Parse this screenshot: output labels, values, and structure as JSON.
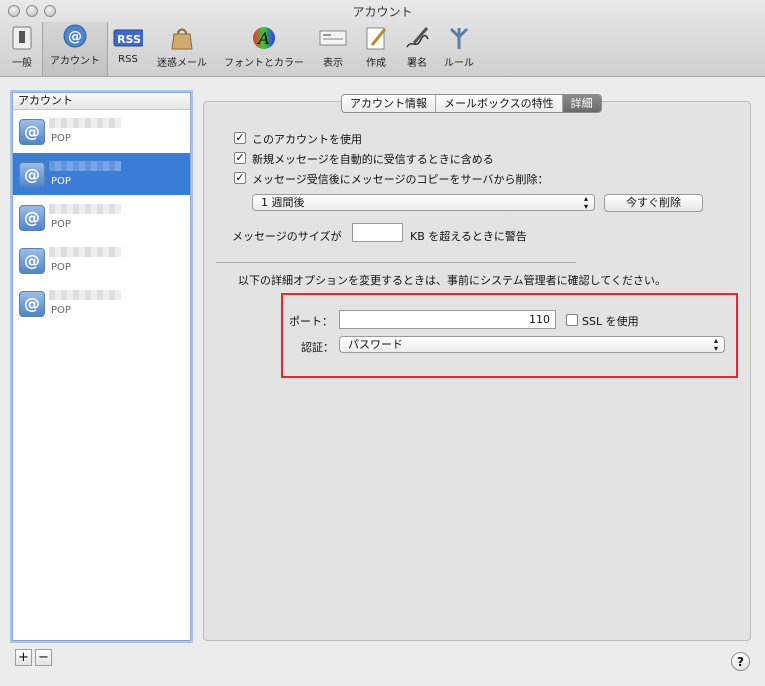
{
  "window": {
    "title": "アカウント"
  },
  "toolbar": {
    "items": [
      {
        "label": "一般",
        "icon": "switch-icon"
      },
      {
        "label": "アカウント",
        "icon": "at-icon"
      },
      {
        "label": "RSS",
        "icon": "rss-icon"
      },
      {
        "label": "迷惑メール",
        "icon": "junk-bag-icon"
      },
      {
        "label": "フォントとカラー",
        "icon": "font-color-icon"
      },
      {
        "label": "表示",
        "icon": "viewing-icon"
      },
      {
        "label": "作成",
        "icon": "compose-icon"
      },
      {
        "label": "署名",
        "icon": "signature-icon"
      },
      {
        "label": "ルール",
        "icon": "rules-icon"
      }
    ],
    "selected": "アカウント"
  },
  "sidebar": {
    "header": "アカウント",
    "accounts": [
      {
        "type": "POP",
        "selected": false
      },
      {
        "type": "POP",
        "selected": true
      },
      {
        "type": "POP",
        "selected": false
      },
      {
        "type": "POP",
        "selected": false
      },
      {
        "type": "POP",
        "selected": false
      }
    ],
    "add_label": "+",
    "remove_label": "−"
  },
  "tabs": [
    {
      "label": "アカウント情報",
      "active": false
    },
    {
      "label": "メールボックスの特性",
      "active": false
    },
    {
      "label": "詳細",
      "active": true
    }
  ],
  "advanced": {
    "enable_account": {
      "label": "このアカウントを使用",
      "checked": true
    },
    "include_auto": {
      "label": "新規メッセージを自動的に受信するときに含める",
      "checked": true
    },
    "remove_copy": {
      "label": "メッセージ受信後にメッセージのコピーをサーバから削除：",
      "checked": true
    },
    "remove_period": "1 週間後",
    "remove_now_button": "今すぐ削除",
    "size_warning_prefix": "メッセージのサイズが",
    "size_warning_value": "",
    "size_warning_suffix": "KB を超えるときに警告",
    "notice": "以下の詳細オプションを変更するときは、事前にシステム管理者に確認してください。",
    "port_label": "ポート：",
    "port_value": "110",
    "ssl": {
      "label": "SSL を使用",
      "checked": false
    },
    "auth_label": "認証：",
    "auth_value": "パスワード"
  },
  "help_label": "?",
  "colors": {
    "selection": "#3b7cd5",
    "highlight": "#e8262b"
  }
}
